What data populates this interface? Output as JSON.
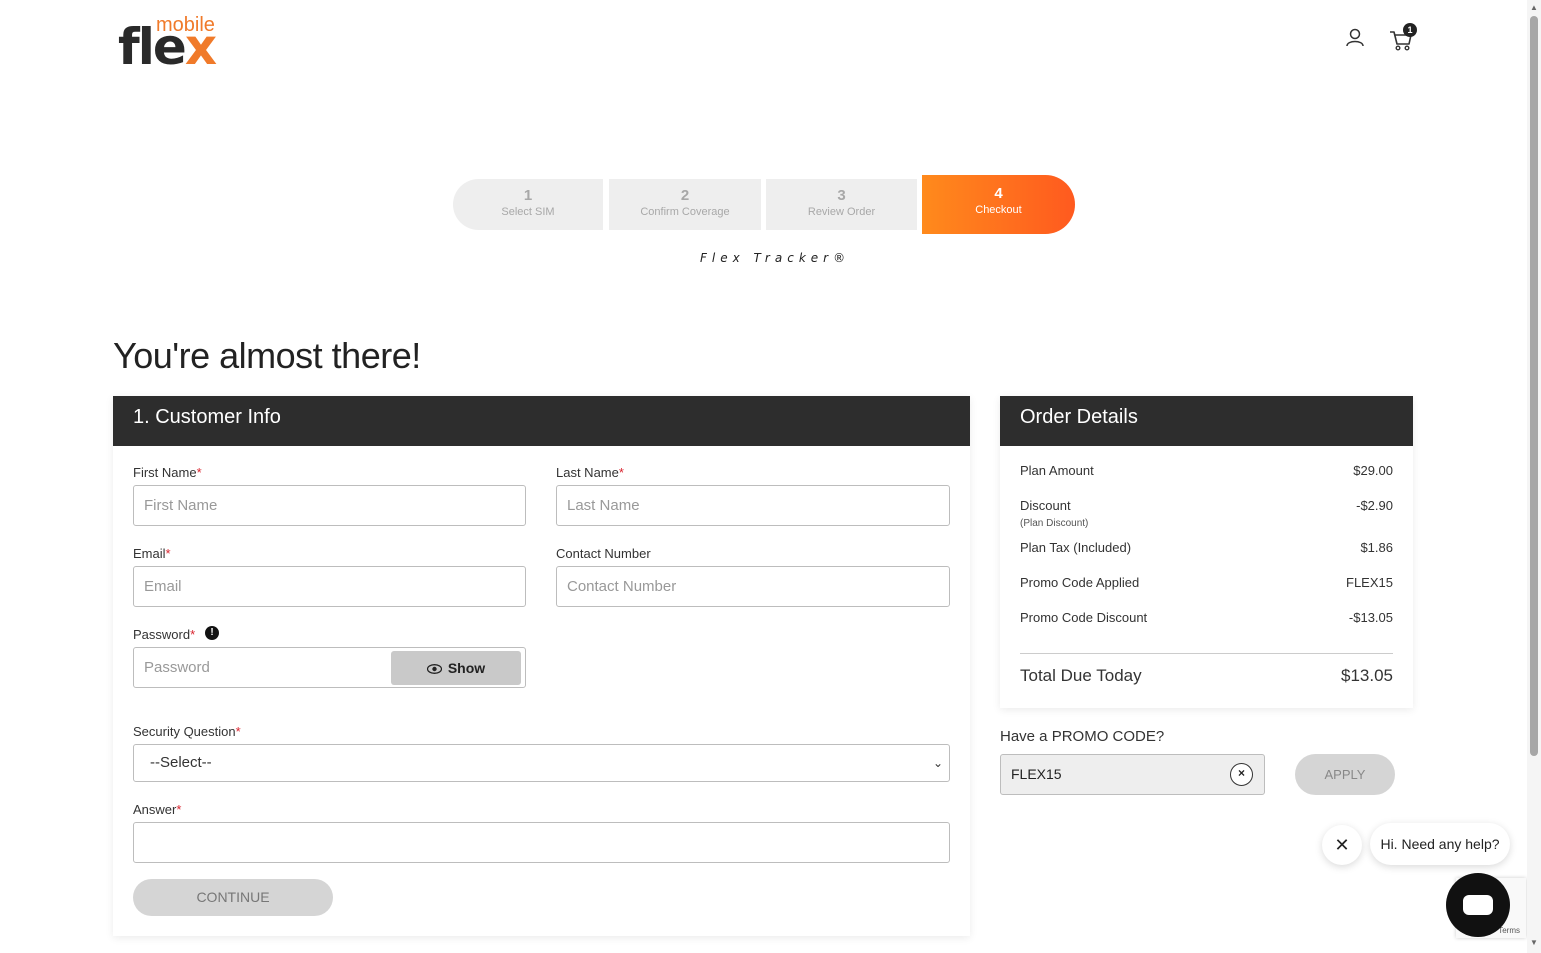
{
  "header": {
    "logo_small": "mobile",
    "logo_main": "fle",
    "logo_x": "x",
    "cart_count": "1"
  },
  "stepper": {
    "steps": [
      {
        "num": "1",
        "label": "Select SIM"
      },
      {
        "num": "2",
        "label": "Confirm Coverage"
      },
      {
        "num": "3",
        "label": "Review Order"
      },
      {
        "num": "4",
        "label": "Checkout"
      }
    ],
    "tracker": "Flex Tracker®",
    "active_color": "#ff6a1f"
  },
  "page_title": "You're almost there!",
  "customer_info": {
    "heading": "1. Customer Info",
    "first_name": {
      "label": "First Name",
      "placeholder": "First Name",
      "required": "*"
    },
    "last_name": {
      "label": "Last Name",
      "placeholder": "Last Name",
      "required": "*"
    },
    "email": {
      "label": "Email",
      "placeholder": "Email",
      "required": "*"
    },
    "contact": {
      "label": "Contact Number",
      "placeholder": "Contact Number"
    },
    "password": {
      "label": "Password",
      "placeholder": "Password",
      "required": "*",
      "info": "!",
      "show_label": "Show"
    },
    "security_question": {
      "label": "Security Question",
      "required": "*",
      "selected": "--Select--"
    },
    "answer": {
      "label": "Answer",
      "required": "*",
      "value": ""
    },
    "continue_label": "CONTINUE"
  },
  "order_details": {
    "heading": "Order Details",
    "rows": [
      {
        "label": "Plan Amount",
        "value": "$29.00"
      },
      {
        "label": "Discount",
        "value": "-$2.90",
        "sub": "(Plan Discount)"
      },
      {
        "label": "Plan Tax (Included)",
        "value": "$1.86"
      },
      {
        "label": "Promo Code Applied",
        "value": "FLEX15"
      },
      {
        "label": "Promo Code Discount",
        "value": "-$13.05"
      }
    ],
    "total_label": "Total Due Today",
    "total_value": "$13.05"
  },
  "promo": {
    "label": "Have a PROMO CODE?",
    "value": "FLEX15",
    "apply_label": "APPLY"
  },
  "chat": {
    "greeting": "Hi. Need any help?",
    "recaptcha_text": "Terms"
  }
}
